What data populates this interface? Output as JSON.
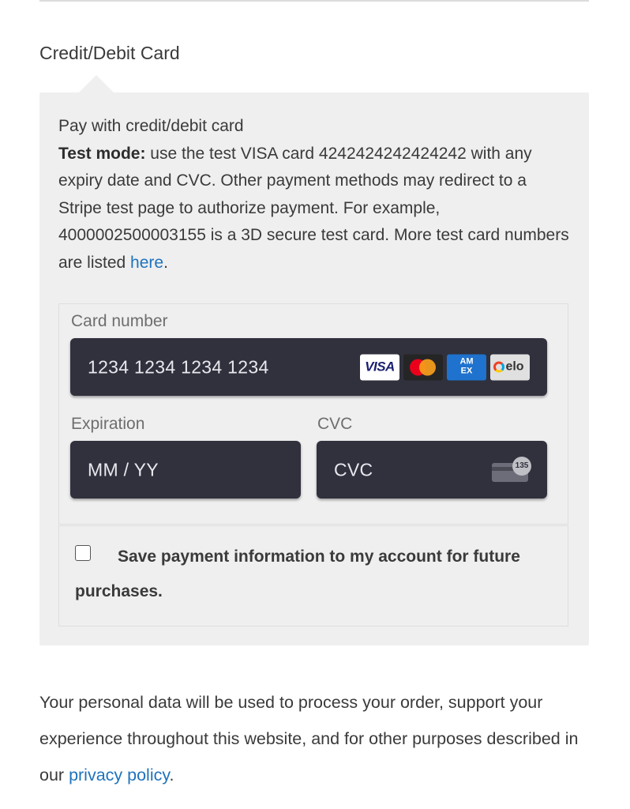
{
  "payment_method": {
    "title": "Credit/Debit Card"
  },
  "description": {
    "intro": "Pay with credit/debit card",
    "test_mode_label": "Test mode:",
    "test_mode_text": " use the test VISA card 4242424242424242 with any expiry date and CVC. Other payment methods may redirect to a Stripe test page to authorize payment. For example, 4000002500003155 is a 3D secure test card. More test card numbers are listed ",
    "here_link": "here",
    "period": "."
  },
  "card_form": {
    "card_number_label": "Card number",
    "card_number_placeholder": "1234 1234 1234 1234",
    "brands": [
      "VISA",
      "Mastercard",
      "AMEX",
      "elo"
    ],
    "expiration_label": "Expiration",
    "expiration_placeholder": "MM / YY",
    "cvc_label": "CVC",
    "cvc_placeholder": "CVC",
    "cvc_icon_number": "135",
    "input_bg_color": "#30313d"
  },
  "save_option": {
    "label": "Save payment information to my account for future purchases.",
    "checked": false
  },
  "privacy": {
    "text": "Your personal data will be used to process your order, support your experience throughout this website, and for other purposes described in our ",
    "link": "privacy policy",
    "period": "."
  },
  "colors": {
    "link": "#1e73be",
    "box_bg": "#efefef"
  }
}
